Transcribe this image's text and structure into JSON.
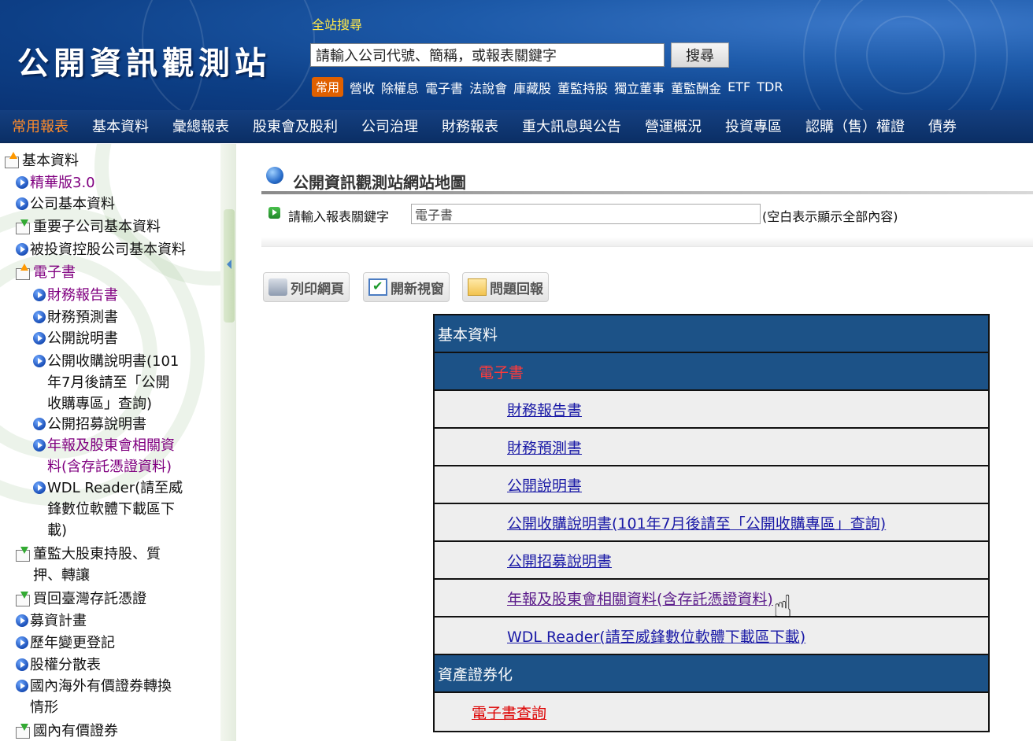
{
  "header": {
    "logo": "公開資訊觀測站",
    "search_label": "全站搜尋",
    "search_placeholder": "請輸入公司代號、簡稱，或報表關鍵字",
    "search_button": "搜尋",
    "quick_badge": "常用",
    "quick_links": [
      "營收",
      "除權息",
      "電子書",
      "法說會",
      "庫藏股",
      "董監持股",
      "獨立董事",
      "董監酬金",
      "ETF",
      "TDR"
    ]
  },
  "nav": {
    "items": [
      "常用報表",
      "基本資料",
      "彙總報表",
      "股東會及股利",
      "公司治理",
      "財務報表",
      "重大訊息與公告",
      "營運概況",
      "投資專區",
      "認購（售）權證",
      "債券"
    ]
  },
  "sidebar": {
    "items": [
      {
        "label": "基本資料"
      },
      {
        "label": "精華版3.0"
      },
      {
        "label": "公司基本資料"
      },
      {
        "label": "重要子公司基本資料"
      },
      {
        "label": "被投資控股公司基本資料"
      },
      {
        "label": "電子書"
      },
      {
        "label": "財務報告書"
      },
      {
        "label": "財務預測書"
      },
      {
        "label": "公開說明書"
      },
      {
        "label": "公開收購說明書(101年7月後請至「公開收購專區」查詢)",
        "lines": [
          "公開收購說明書(101",
          "年7月後請至「公開",
          "收購專區」查詢)"
        ]
      },
      {
        "label": "公開招募說明書"
      },
      {
        "label": "年報及股東會相關資料(含存託憑證資料)",
        "lines": [
          "年報及股東會相關資",
          "料(含存託憑證資料)"
        ]
      },
      {
        "label": "WDL Reader(請至威鋒數位軟體下載區下載)",
        "lines": [
          "WDL Reader(請至威",
          "鋒數位軟體下載區下",
          "載)"
        ]
      },
      {
        "label": "董監大股東持股、質押、轉讓",
        "lines": [
          "董監大股東持股、質",
          "押、轉讓"
        ]
      },
      {
        "label": "買回臺灣存託憑證"
      },
      {
        "label": "募資計畫"
      },
      {
        "label": "歷年變更登記"
      },
      {
        "label": "股權分散表"
      },
      {
        "label": "國內海外有價證券轉換情形",
        "lines": [
          "國內海外有價證券轉換",
          "情形"
        ]
      },
      {
        "label": "國內有價證券"
      }
    ]
  },
  "main": {
    "title": "公開資訊觀測站網站地圖",
    "keyword_label": "請輸入報表關鍵字",
    "keyword_value": "電子書",
    "keyword_hint": "(空白表示顯示全部內容)",
    "tools": {
      "print": "列印網頁",
      "new_window": "開新視窗",
      "feedback": "問題回報"
    },
    "sitemap": {
      "section1": "基本資料",
      "subsection": "電子書",
      "items": [
        "財務報告書",
        "財務預測書",
        "公開說明書",
        "公開收購說明書(101年7月後請至「公開收購專區」查詢)",
        "公開招募說明書",
        "年報及股東會相關資料(含存託憑證資料)",
        "WDL Reader(請至威鋒數位軟體下載區下載)"
      ],
      "section2": "資產證券化",
      "section2_item": "電子書查詢"
    }
  },
  "colors": {
    "nav_active": "#ff8c2a",
    "table_header": "#1c5287",
    "link": "#1a1aa6",
    "visited": "#800080"
  }
}
